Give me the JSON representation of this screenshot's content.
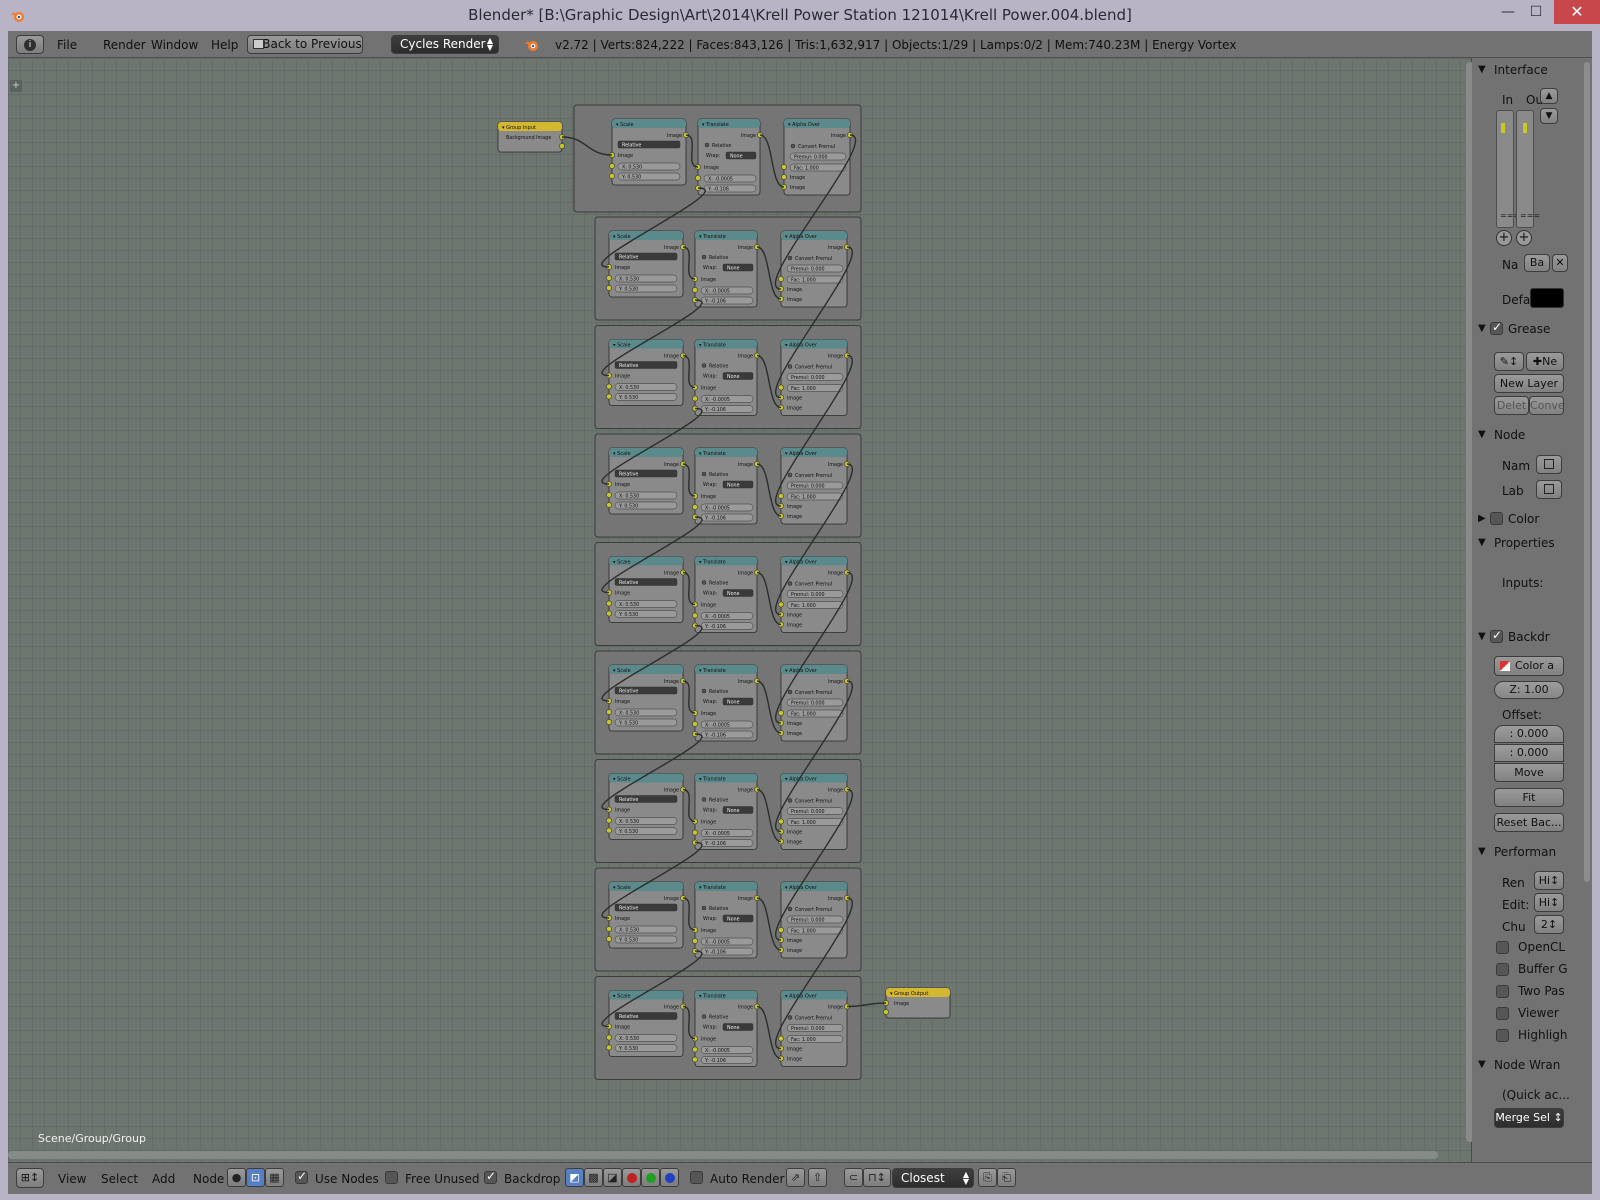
{
  "window": {
    "title": "Blender* [B:\\Graphic Design\\Art\\2014\\Krell Power Station 121014\\Krell Power.004.blend]",
    "minimize": "—",
    "maximize": "☐",
    "close": "✕"
  },
  "infobar": {
    "menus": [
      "File",
      "Render",
      "Window",
      "Help"
    ],
    "back_button": "Back to Previous",
    "render_engine": "Cycles Render",
    "stats": "v2.72 | Verts:824,222 | Faces:843,126 | Tris:1,632,917 | Objects:1/29 | Lamps:0/2 | Mem:740.23M | Energy Vortex"
  },
  "node_editor": {
    "breadcrumb": "Scene/Group/Group",
    "group_input": {
      "title": "Group Input",
      "socket": "Background Image"
    },
    "group_output": {
      "title": "Group Output",
      "socket": "Image"
    },
    "frame_count": 9,
    "scale_node": {
      "title": "Scale",
      "out": "Image",
      "mode": "Relative",
      "in": "Image",
      "x": "X: 0.530",
      "y": "Y: 0.530"
    },
    "translate_node": {
      "title": "Translate",
      "out": "Image",
      "relative": "Relative",
      "wrap_label": "Wrap:",
      "wrap": "None",
      "in": "Image",
      "x": "X: -0.0005",
      "y": "Y: -0.106"
    },
    "alphaover_node": {
      "title": "Alpha Over",
      "out": "Image",
      "convert": "Convert Premul",
      "premul": "Premul: 0.000",
      "fac": "Fac: 1.000",
      "in1": "Image",
      "in2": "Image"
    }
  },
  "sidebar": {
    "interface": {
      "header": "Interface",
      "in": "In",
      "out": "Ou",
      "name_label": "Na",
      "name_value": "Ba",
      "default_label": "Defa"
    },
    "grease": {
      "header": "Grease",
      "new": "Ne",
      "new_layer": "New Layer",
      "delete": "Delet",
      "convert": "Conve"
    },
    "node": {
      "header": "Node",
      "name_label": "Nam",
      "label_label": "Lab"
    },
    "color": {
      "header": "Color"
    },
    "properties": {
      "header": "Properties",
      "inputs": "Inputs:"
    },
    "backdrop": {
      "header": "Backdr",
      "channels": "Color a",
      "zoom": "Z: 1.00",
      "offset_label": "Offset:",
      "offset_x": ": 0.000",
      "offset_y": ": 0.000",
      "move": "Move",
      "fit": "Fit",
      "reset": "Reset Bac..."
    },
    "performance": {
      "header": "Performan",
      "render_label": "Ren",
      "render_value": "Hi",
      "edit_label": "Edit:",
      "edit_value": "Hi",
      "chunk_label": "Chu",
      "chunk_value": "2",
      "options": [
        "OpenCL",
        "Buffer G",
        "Two Pas",
        "Viewer",
        "Highligh"
      ]
    },
    "node_wrangler": {
      "header": "Node Wran",
      "quick": "(Quick ac...",
      "merge": "Merge Sel"
    }
  },
  "bottombar": {
    "menus": [
      "View",
      "Select",
      "Add",
      "Node"
    ],
    "use_nodes": "Use Nodes",
    "free_unused": "Free Unused",
    "backdrop": "Backdrop",
    "auto_render": "Auto Render",
    "interpolation": "Closest"
  },
  "colors": {
    "editor_bg": "#6d756f",
    "frame_bg": "#757575",
    "node_header": "#5b8a8d",
    "group_node_header": "#d3b730",
    "socket": "#c7c729"
  }
}
